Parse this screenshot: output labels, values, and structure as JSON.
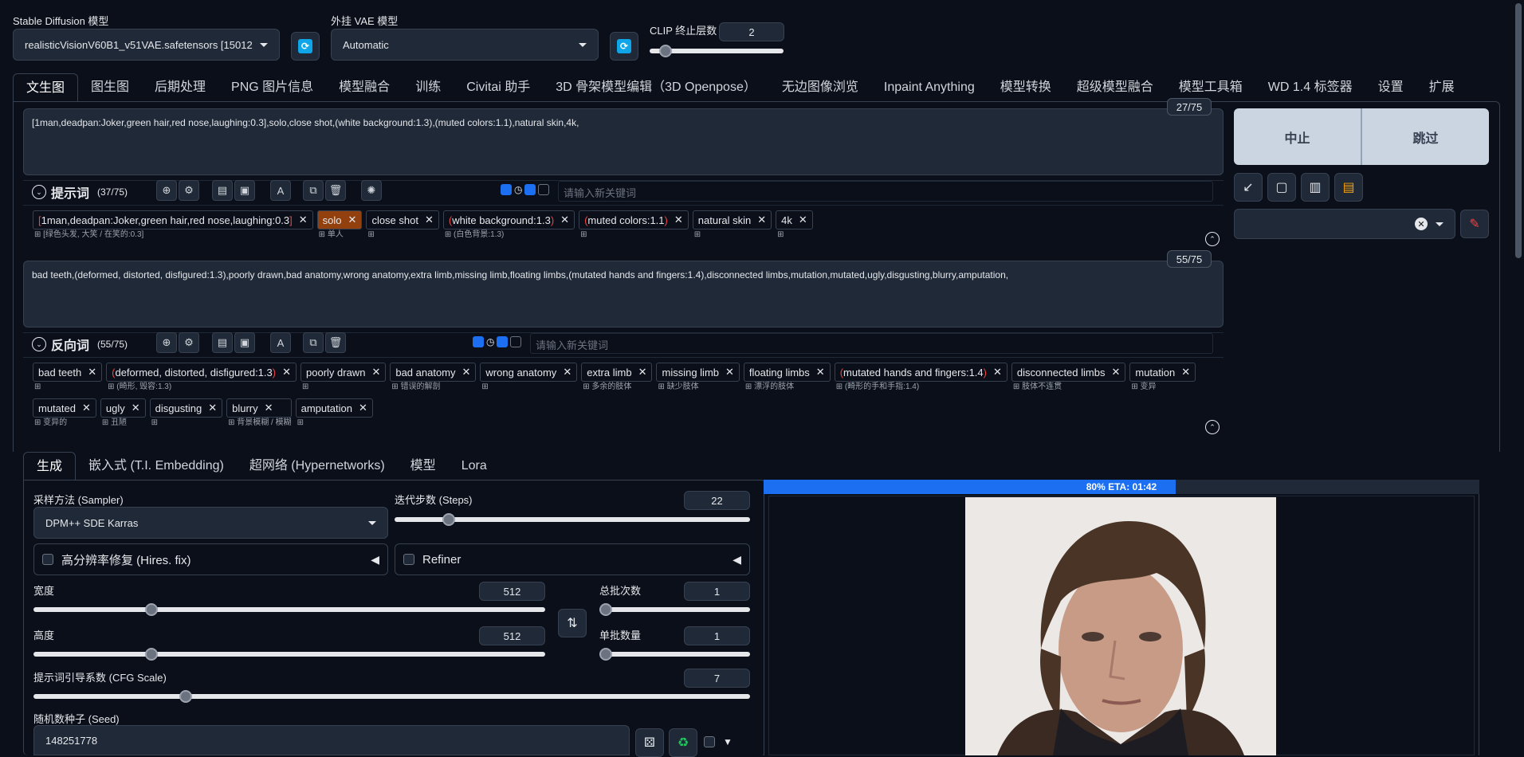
{
  "top": {
    "sd_model_label": "Stable Diffusion 模型",
    "sd_model_value": "realisticVisionV60B1_v51VAE.safetensors [15012",
    "vae_label": "外挂 VAE 模型",
    "vae_value": "Automatic",
    "clip_label": "CLIP 终止层数",
    "clip_value": "2"
  },
  "main_tabs": [
    "文生图",
    "图生图",
    "后期处理",
    "PNG 图片信息",
    "模型融合",
    "训练",
    "Civitai 助手",
    "3D 骨架模型编辑（3D Openpose）",
    "无边图像浏览",
    "Inpaint Anything",
    "模型转换",
    "超级模型融合",
    "模型工具箱",
    "WD 1.4 标签器",
    "设置",
    "扩展"
  ],
  "prompt": {
    "text": "[1man,deadpan:Joker,green hair,red nose,laughing:0.3],solo,close shot,(white background:1.3),(muted colors:1.1),natural skin,4k,",
    "token_count": "27/75",
    "header_label": "提示词",
    "header_count": "(37/75)",
    "keyword_placeholder": "请输入新关键词",
    "tags": [
      {
        "pre": "[",
        "text": "1man,deadpan:Joker,green hair,red nose,laughing:0.3",
        "post": "]",
        "sub": "[绿色头发, 大笑 / 在笑的:0.3]"
      },
      {
        "text": "solo",
        "sub": "单人",
        "highlight": true
      },
      {
        "text": "close shot",
        "sub": ""
      },
      {
        "pre": "(",
        "text": "white background:1.3",
        "post": ")",
        "sub": "(白色背景:1.3)"
      },
      {
        "pre": "(",
        "text": "muted colors:1.1",
        "post": ")",
        "sub": ""
      },
      {
        "text": "natural skin",
        "sub": ""
      },
      {
        "text": "4k",
        "sub": ""
      }
    ]
  },
  "negative": {
    "text": "bad teeth,(deformed, distorted, disfigured:1.3),poorly drawn,bad anatomy,wrong anatomy,extra limb,missing limb,floating limbs,(mutated hands and fingers:1.4),disconnected limbs,mutation,mutated,ugly,disgusting,blurry,amputation,",
    "token_count": "55/75",
    "header_label": "反向词",
    "header_count": "(55/75)",
    "keyword_placeholder": "请输入新关键词",
    "tags_row1": [
      {
        "text": "bad teeth",
        "sub": ""
      },
      {
        "pre": "(",
        "text": "deformed, distorted, disfigured:1.3",
        "post": ")",
        "sub": "(畸形, 毁容:1.3)"
      },
      {
        "text": "poorly drawn",
        "sub": ""
      },
      {
        "text": "bad anatomy",
        "sub": "错误的解剖"
      },
      {
        "text": "wrong anatomy",
        "sub": ""
      },
      {
        "text": "extra limb",
        "sub": "多余的肢体"
      },
      {
        "text": "missing limb",
        "sub": "缺少肢体"
      },
      {
        "text": "floating limbs",
        "sub": "漂浮的肢体"
      },
      {
        "pre": "(",
        "text": "mutated hands and fingers:1.4",
        "post": ")",
        "sub": "(畸形的手和手指:1.4)"
      },
      {
        "text": "disconnected limbs",
        "sub": "肢体不连贯"
      },
      {
        "text": "mutation",
        "sub": "变异"
      }
    ],
    "tags_row2": [
      {
        "text": "mutated",
        "sub": "变异的"
      },
      {
        "text": "ugly",
        "sub": "丑陋"
      },
      {
        "text": "disgusting",
        "sub": ""
      },
      {
        "text": "blurry",
        "sub": "背景模糊 / 模糊"
      },
      {
        "text": "amputation",
        "sub": ""
      }
    ]
  },
  "actions": {
    "interrupt": "中止",
    "skip": "跳过"
  },
  "sub_tabs": [
    "生成",
    "嵌入式 (T.I. Embedding)",
    "超网络 (Hypernetworks)",
    "模型",
    "Lora"
  ],
  "params": {
    "sampler_label": "采样方法 (Sampler)",
    "sampler_value": "DPM++ SDE Karras",
    "steps_label": "迭代步数 (Steps)",
    "steps_value": "22",
    "hires_label": "高分辨率修复 (Hires. fix)",
    "refiner_label": "Refiner",
    "width_label": "宽度",
    "width_value": "512",
    "height_label": "高度",
    "height_value": "512",
    "batch_count_label": "总批次数",
    "batch_count_value": "1",
    "batch_size_label": "单批数量",
    "batch_size_value": "1",
    "cfg_label": "提示词引导系数 (CFG Scale)",
    "cfg_value": "7",
    "seed_label": "随机数种子 (Seed)",
    "seed_value": "148251778"
  },
  "progress": {
    "text": "80% ETA: 01:42",
    "fraction": 0.8
  }
}
